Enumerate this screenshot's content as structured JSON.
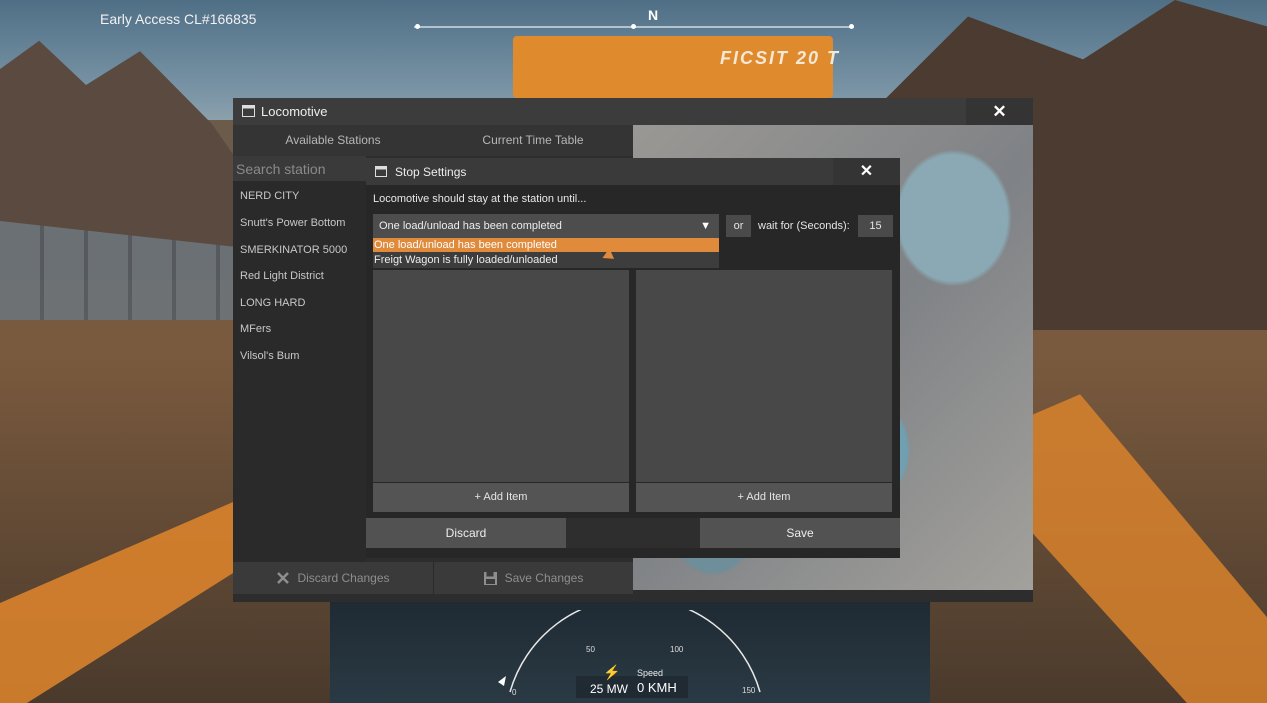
{
  "hud": {
    "build_label": "Early Access CL#166835",
    "compass_heading": "N",
    "roof_label": "FICSIT 20 T",
    "speed_label": "Speed",
    "speed_value": "0 KMH",
    "power_value": "25 MW",
    "speed_ticks": [
      "0",
      "50",
      "100",
      "150"
    ]
  },
  "locomotive": {
    "title": "Locomotive",
    "tabs": [
      {
        "label": "Available Stations"
      },
      {
        "label": "Current Time Table"
      }
    ],
    "search": {
      "placeholder": "Search station",
      "value": ""
    },
    "stations": [
      "NERD CITY",
      "Snutt's Power Bottom",
      "SMERKINATOR 5000",
      "Red Light District",
      "LONG HARD",
      "MFers",
      "Vilsol's Bum"
    ],
    "discard_changes_label": "Discard Changes",
    "save_changes_label": "Save Changes"
  },
  "stop_settings": {
    "title": "Stop Settings",
    "instruction": "Locomotive should stay at the station until...",
    "selected_condition": "One load/unload has been completed",
    "condition_options": [
      "One load/unload has been completed",
      "Freigt Wagon is fully loaded/unloaded"
    ],
    "or_label": "or",
    "wait_label": "wait for (Seconds):",
    "wait_seconds": "15",
    "add_item_left": "+ Add Item",
    "add_item_right": "+ Add Item",
    "discard_label": "Discard",
    "save_label": "Save"
  },
  "colors": {
    "accent": "#e08a3b",
    "panel": "#2d2d2d",
    "title_bar": "#3c3c3c"
  }
}
